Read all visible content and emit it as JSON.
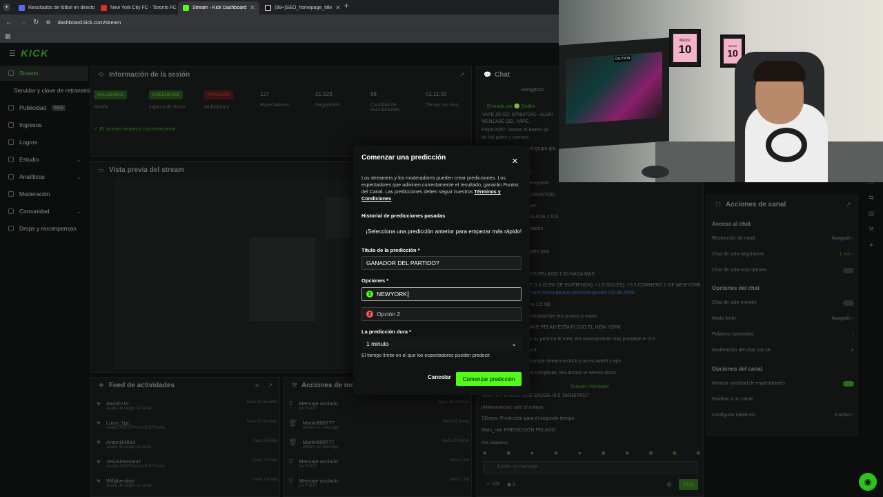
{
  "browser": {
    "tabs": [
      {
        "title": "Resultados de fútbol en directo",
        "color": "#5b6cf0"
      },
      {
        "title": "New York City FC - Toronto FC",
        "color": "#d93025"
      },
      {
        "title": "Stream - Kick Dashboard",
        "color": "#53fc18"
      },
      {
        "title": "(99+)SEO_homepage_title",
        "color": "#ffffff"
      }
    ],
    "new_tab": "+",
    "url": "dashboard.kick.com/stream"
  },
  "sidebar": {
    "items": [
      {
        "label": "Stream"
      },
      {
        "label": "Servidor y clave de retransmisión"
      },
      {
        "label": "Publicidad",
        "badge": "Beta"
      },
      {
        "label": "Ingresos"
      },
      {
        "label": "Logros"
      },
      {
        "label": "Estudio"
      },
      {
        "label": "Analíticas"
      },
      {
        "label": "Moderación"
      },
      {
        "label": "Comunidad"
      },
      {
        "label": "Drops y recompensas"
      }
    ]
  },
  "session": {
    "title": "Información de la sesión",
    "stats": [
      {
        "chip": "SALUDABLE",
        "label": "Sesión"
      },
      {
        "chip": "ENCENDIDO",
        "label": "Ingreso de Socio"
      },
      {
        "chip": "APAGADO",
        "label": "Multistream"
      },
      {
        "value": "127",
        "label": "Espectadores"
      },
      {
        "value": "21.523",
        "label": "Seguidores"
      },
      {
        "value": "88",
        "label": "Cantidad de suscripciones"
      },
      {
        "value": "01:11:00",
        "label": "Tiempo en vivo"
      }
    ],
    "status": "El stream empezó correctamente."
  },
  "preview": {
    "title": "Vista previa del stream"
  },
  "feed": {
    "title": "Feed de actividades",
    "items": [
      {
        "name": "davidrv10",
        "sub": "acaba de seguir al canal",
        "time": "hace 12 minutos"
      },
      {
        "name": "Luiss_1gc",
        "sub": "canjeó AJUSTAAA AJUSTAAAA",
        "time": "hace 12 minutos"
      },
      {
        "name": "Antoni148xd",
        "sub": "acaba de seguir al canal",
        "time": "hace 2 horas"
      },
      {
        "name": "JesusMamani2",
        "sub": "canjeó AJUSTAAA AJUSTAAAA",
        "time": "hace 2 horas"
      },
      {
        "name": "Willyberdejo",
        "sub": "acaba de seguir al canal",
        "time": "hace 2 horas"
      }
    ]
  },
  "modactions": {
    "title": "Acciones de mod",
    "items": [
      {
        "name": "Mensaje anclado",
        "sub": "por Fat10",
        "time": "hace 20 minutos"
      },
      {
        "name": "Martin888777",
        "sub": "eliminó un mensaje",
        "time": "hace 23 horas"
      },
      {
        "name": "Martin888777",
        "sub": "eliminó un mensaje",
        "time": "hace 23 horas"
      },
      {
        "name": "Mensaje anclado",
        "sub": "por Fat10",
        "time": "hace 1 día"
      },
      {
        "name": "Mensaje anclado",
        "sub": "por Fat10",
        "time": "hace 1 día"
      }
    ]
  },
  "chat": {
    "title": "Chat",
    "lines": [
      "Hahggtxd1",
      "Enviado por 🟢 Sodtis",
      "YAPE 20 SO: 975947242 - ALVAI",
      "MENSAJE DEL YAPE.",
      "Pispin1097: lastmo lo bueno qu",
      "de full goles y corners",
      "el grupo gra",
      "L",
      "emparon",
      "ORONTOO",
      "ato",
      "ALIO E 1.5 G",
      "dados",
      "pate piso",
      "OS PELADO 1.60 NADA MAS",
      "E 3.5 (3.5% DE INVERSION): +1.5 GOLES), +5.5 CORNERS Y GF NEWYORK",
      "https://www.betano.pe/bookingcode/YQURUPBB",
      "ra 1.6 XD",
      "pelaado fue mis puntos p mano",
      "AVE PELAD ESTA FLOJO EL NEW YORK",
      "o si, pero no le meti, era teoricamente mas probable el 2-0",
      "a 3",
      "porque stream en kick y no en twicht x ejm",
      "te complicas, era ambos le hemos dicho",
      "Nuevos mensajes",
      "Jhon_lrm: CREES QUE SALGA +6.5 TARJETAS?",
      "jhillawinoficial: sale el ambos",
      "SDarys: Predicción para el segundo tiempo",
      "Mats_rwr: PREDICCION PELADO",
      "Nos seguimos"
    ],
    "input_placeholder": "Enviar un mensaje",
    "count1": "CO",
    "count2": "0",
    "send": "Chat"
  },
  "channel_actions": {
    "title": "Acciones de canal",
    "sections": [
      {
        "head": "Acceso al chat",
        "rows": [
          {
            "label": "Restricción de edad",
            "value": "Apagado"
          },
          {
            "label": "Chat de solo-seguidores",
            "value": "1 min"
          },
          {
            "label": "Chat de solo-suscriptores",
            "value": ""
          }
        ]
      },
      {
        "head": "Opciones del chat",
        "rows": [
          {
            "label": "Chat de solo-emotes",
            "value": ""
          },
          {
            "label": "Modo lento",
            "value": "Apagado"
          },
          {
            "label": "Palabras baneadas",
            "value": ""
          },
          {
            "label": "Moderación del chat con IA",
            "value": ""
          }
        ]
      },
      {
        "head": "Opciones del canal",
        "rows": [
          {
            "label": "Mostrar cantidad de espectadores",
            "value": ""
          },
          {
            "label": "Raidear a un canal",
            "value": ""
          },
          {
            "label": "Configurar objetivos",
            "value": "0 activo"
          }
        ]
      }
    ]
  },
  "modal": {
    "title": "Comenzar una predicción",
    "description": "Los streamers y los moderadores pueden crear predicciones. Los espectadores que adivinen correctamente el resultado, ganarán Puntos del Canal. Las predicciones deben seguir nuestros ",
    "terms": "Términos y Condiciones",
    "terms_end": ".",
    "history_label": "Historial de predicciones pasadas",
    "history_text": "¡Selecciona una predicción anterior para empezar más rápido!",
    "title_label": "Título de la predicción *",
    "title_value": "GANADOR DEL PARTIDO?",
    "options_label": "Opciones *",
    "option1_num": "1",
    "option1_value": "NEWYORK",
    "option2_num": "2",
    "option2_placeholder": "Opción 2",
    "duration_label": "La predicción dura *",
    "duration_value": "1 minuto",
    "duration_hint": "El tiempo límite en el que los espectadores pueden predecir.",
    "cancel": "Cancelar",
    "submit": "Comenzar predicción",
    "colors": {
      "option1": "#53fc18",
      "option2": "#ff5c5c",
      "accent": "#53fc18"
    }
  },
  "webcam": {
    "poster1_top": "MESSI",
    "poster1_num": "10",
    "poster2_top": "MESSI",
    "poster2_num": "10",
    "pc_label": "CAUTION"
  }
}
